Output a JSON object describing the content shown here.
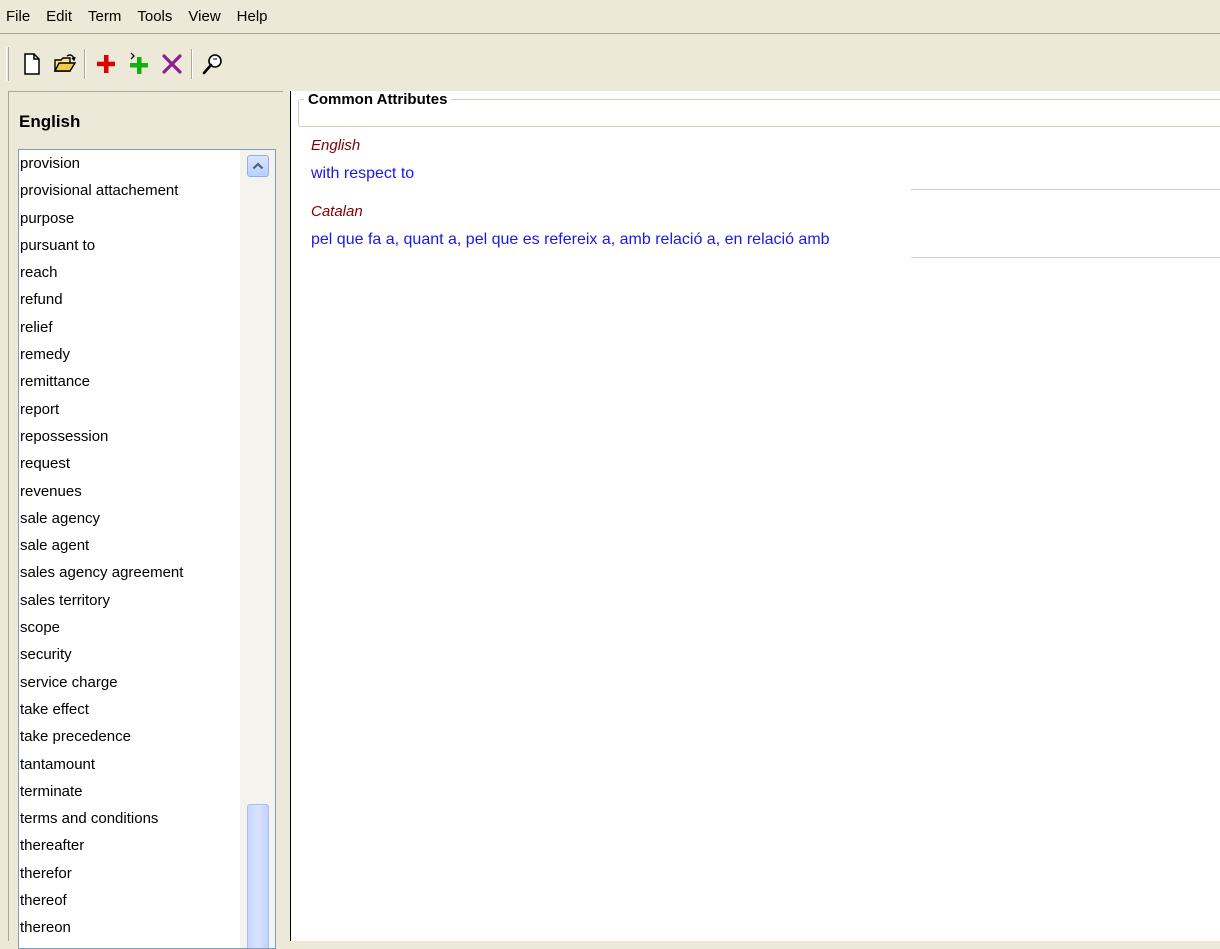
{
  "menu": [
    "File",
    "Edit",
    "Term",
    "Tools",
    "View",
    "Help"
  ],
  "toolbar": {
    "icons": [
      "new-document-icon",
      "open-folder-icon",
      "add-term-icon",
      "add-subterm-icon",
      "delete-icon",
      "search-icon"
    ],
    "colors": {
      "add": "#e00000",
      "add_sub": "#10b010",
      "delete": "#8b2090"
    }
  },
  "left_pane": {
    "title": "English",
    "terms": [
      "provision",
      "provisional attachement",
      "purpose",
      "pursuant to",
      "reach",
      "refund",
      "relief",
      "remedy",
      "remittance",
      "report",
      "repossession",
      "request",
      "revenues",
      "sale agency",
      "sale agent",
      "sales agency agreement",
      "sales territory",
      "scope",
      "security",
      "service charge",
      "take effect",
      "take precedence",
      "tantamount",
      "terminate",
      "terms and conditions",
      "thereafter",
      "therefor",
      "thereof",
      "thereon"
    ]
  },
  "right_pane": {
    "group_title": "Common Attributes",
    "entries": [
      {
        "language": "English",
        "value": "with respect to"
      },
      {
        "language": "Catalan",
        "value": "pel que fa a, quant a, pel que es refereix a, amb relació a, en relació amb"
      }
    ],
    "colors": {
      "language": "#800000",
      "value": "#1a1ae6"
    }
  }
}
